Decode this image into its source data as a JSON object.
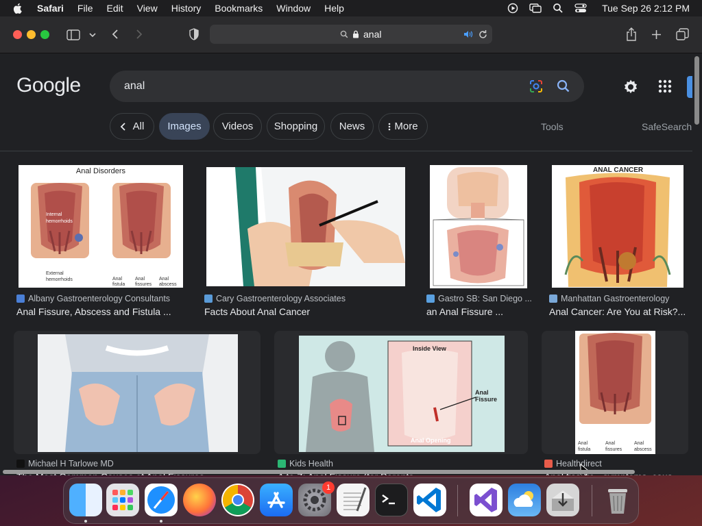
{
  "menubar": {
    "app": "Safari",
    "items": [
      "File",
      "Edit",
      "View",
      "History",
      "Bookmarks",
      "Window",
      "Help"
    ],
    "clock": "Tue Sep 26  2:12 PM"
  },
  "browser": {
    "address_text": "anal"
  },
  "google": {
    "logo": "Google",
    "query": "anal",
    "chips": {
      "all": "All",
      "images": "Images",
      "videos": "Videos",
      "shopping": "Shopping",
      "news": "News",
      "more": "More"
    },
    "tools": "Tools",
    "safesearch": "SafeSearch"
  },
  "results": [
    {
      "source": "Albany Gastroenterology Consultants",
      "title": "Anal Fissure, Abscess and Fistula ...",
      "thumb_label": "Anal Disorders",
      "fav_color": "#4a7fd6"
    },
    {
      "source": "Cary Gastroenterology Associates",
      "title": "Facts About Anal Cancer",
      "fav_color": "#5a9bd8"
    },
    {
      "source": "Gastro SB: San Diego ...",
      "title": "an Anal Fissure ...",
      "fav_color": "#5aa0e0"
    },
    {
      "source": "Manhattan Gastroenterology",
      "title": "Anal Cancer: Are You at Risk?...",
      "thumb_label": "ANAL CANCER",
      "fav_color": "#7aa8d8"
    },
    {
      "source": "Michael H Tarlowe MD",
      "title": "The Most Common Causes of Anal Fissures",
      "fav_color": "#111111"
    },
    {
      "source": "Kids Health",
      "title": "A to Z: Anal Fissure (for Parents",
      "thumb_label_1": "Inside View",
      "thumb_label_2": "Anal Fissure",
      "thumb_label_3": "Anal Opening",
      "fav_color": "#2bb673"
    },
    {
      "source": "Healthdirect",
      "title": "Anal fissure - symptoms, caus",
      "fav_color": "#e85c4a"
    }
  ],
  "dock": {
    "notification_badge": "1",
    "colors": {
      "finder": "#2a8cf0",
      "launchpad": "#e0e0e0",
      "safari": "#1e90ff",
      "firefox": "#ff7139",
      "chrome": "#db4437",
      "appstore": "#1b8cf2",
      "settings": "#8e8e93",
      "textedit": "#f5f5f5",
      "terminal": "#1c1c1e",
      "vscode": "#0078d4",
      "vs": "#7b4fd0",
      "weather": "#3a9be8",
      "installer": "#d6d6d6",
      "trash": "#a0a0a0"
    }
  }
}
